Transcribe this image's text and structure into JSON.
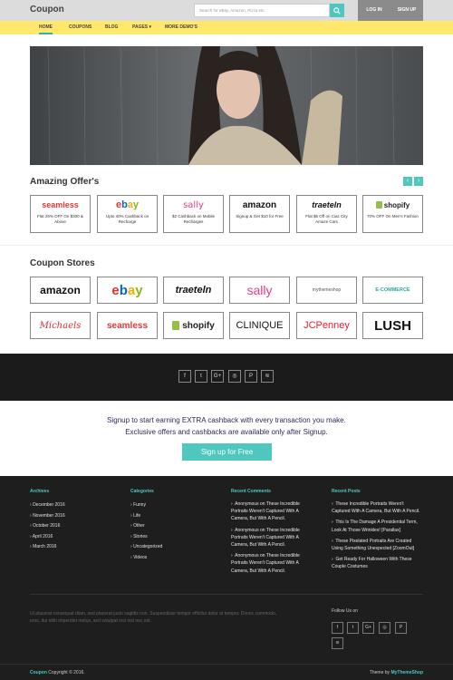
{
  "header": {
    "logo": "Coupon",
    "search_placeholder": "Search for eBay, Amazon, Pizza etc.",
    "login": "LOG IN",
    "signup": "SIGN UP"
  },
  "nav": [
    "HOME",
    "COUPONS",
    "BLOG",
    "PAGES",
    "MORE DEMO'S"
  ],
  "offers": {
    "title": "Amazing Offer's",
    "items": [
      {
        "brand": "seamless",
        "text": "Flat 25% OFF On $300 & Above"
      },
      {
        "brand": "ebay",
        "text": "Upto 40% Cashback on Recharge"
      },
      {
        "brand": "sally",
        "text": "$2 Cashback on Mobile Recharges"
      },
      {
        "brand": "amazon",
        "text": "Signup & Get $10 for Free"
      },
      {
        "brand": "traeteln",
        "text": "Flat $6 Off on Ciaz City Amaze Cars"
      },
      {
        "brand": "shopify",
        "text": "70% OFF On Men's Fashion"
      }
    ]
  },
  "stores": {
    "title": "Coupon Stores",
    "row1": [
      "amazon",
      "ebay",
      "traeteln",
      "sally",
      "mythemeshop",
      "E-COMMERCE"
    ],
    "row2": [
      "Michaels",
      "seamless",
      "shopify",
      "CLINIQUE",
      "JCPenney",
      "LUSH"
    ]
  },
  "brand_logos": {
    "seamless": "seamless",
    "ebay": "ebay",
    "sally": "sally",
    "amazon": "amazon",
    "traeteln": "traeteln",
    "shopify": "shopify",
    "mythemeshop": "mythemeshop",
    "ecommerce": "E-COMMERCE",
    "michaels": "Michaels",
    "clinique": "CLINIQUE",
    "jcpenney": "JCPenney",
    "lush": "LUSH"
  },
  "signup": {
    "line1": "Signup to start earning EXTRA cashback with every transaction you make.",
    "line2": "Exclusive offers and cashbacks are available only after Signup.",
    "button": "Sign up for Free"
  },
  "footer": {
    "archives_title": "Archives",
    "archives": [
      "December 2016",
      "November 2016",
      "October 2016",
      "April 2016",
      "March 2016"
    ],
    "categories_title": "Categories",
    "categories": [
      "Funny",
      "Life",
      "Other",
      "Stories",
      "Uncategorized",
      "Videos"
    ],
    "comments_title": "Recent Comments",
    "comments": [
      "Anonymous on These Incredible Portraits Weren't Captured With A Camera, But With A Pencil.",
      "Anonymous on These Incredible Portraits Weren't Captured With A Camera, But With A Pencil.",
      "Anonymous on These Incredible Portraits Weren't Captured With A Camera, But With A Pencil."
    ],
    "posts_title": "Recent Posts",
    "posts": [
      "These Incredible Portraits Weren't Captured With A Camera, But With A Pencil.",
      "This Is The Damage A Presidential Term, Look At Those Wrinkles! [Parallax]",
      "These Pixelated Portraits Are Created Using Something Unexpected [ZoomOut]",
      "Get Ready For Halloween With These Couple Costumes"
    ],
    "about": "Ut placerat consequat diam, sed placerat justo sagittis non. Suspendisse tempor efficitur dolor at tempor. Donec commodo, eros, dui nibh imperdiet metus, sed volutpat orci nisl nec est.",
    "follow_title": "Follow Us on",
    "copyright_brand": "Coupon",
    "copyright_text": " Copyright © 2016.",
    "theme_text": "Theme by ",
    "theme_brand": "MyThemeShop"
  },
  "colors": {
    "accent": "#4fc7bf",
    "nav_bg": "#ffe86b",
    "topbar_bg": "#dcdcdc",
    "dark": "#1e1e1e"
  }
}
